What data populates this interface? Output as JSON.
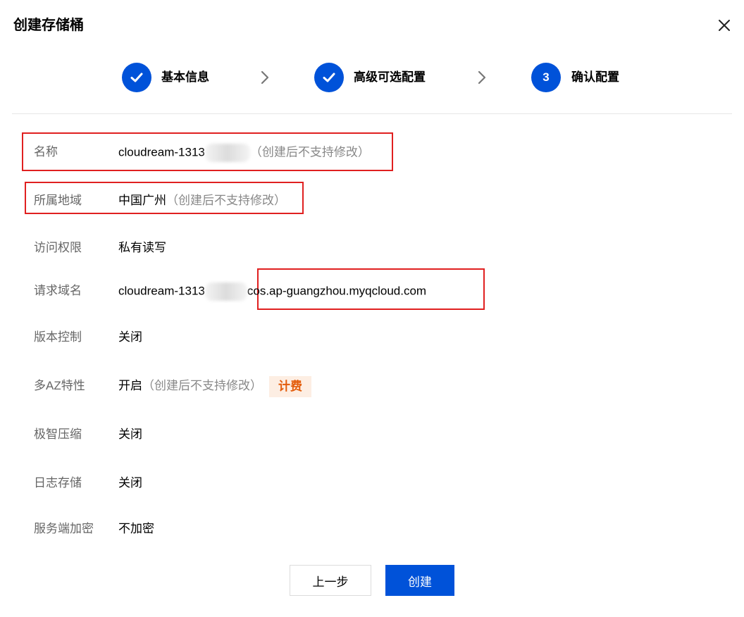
{
  "dialog": {
    "title": "创建存储桶",
    "close_icon": "close-icon"
  },
  "steps": [
    {
      "label": "基本信息",
      "status": "done",
      "icon": "check-icon"
    },
    {
      "label": "高级可选配置",
      "status": "done",
      "icon": "check-icon"
    },
    {
      "label": "确认配置",
      "status": "current",
      "number": "3"
    }
  ],
  "step_separator_icon": "chevron-right-icon",
  "fields": {
    "name": {
      "label": "名称",
      "value": "cloudream-1313",
      "note": "（创建后不支持修改）"
    },
    "region": {
      "label": "所属地域",
      "value": "中国广州",
      "note": "（创建后不支持修改）"
    },
    "access": {
      "label": "访问权限",
      "value": "私有读写"
    },
    "domain": {
      "label": "请求域名",
      "value_prefix": "cloudream-1313",
      "value_suffix": "cos.ap-guangzhou.myqcloud.com"
    },
    "versioning": {
      "label": "版本控制",
      "value": "关闭"
    },
    "multi_az": {
      "label": "多AZ特性",
      "value": "开启",
      "note": "（创建后不支持修改）",
      "badge": "计费"
    },
    "compression": {
      "label": "极智压缩",
      "value": "关闭"
    },
    "logging": {
      "label": "日志存储",
      "value": "关闭"
    },
    "encryption": {
      "label": "服务端加密",
      "value": "不加密"
    }
  },
  "buttons": {
    "prev": "上一步",
    "create": "创建"
  },
  "colors": {
    "primary": "#0052d9",
    "highlight_border": "#e02020",
    "badge_bg": "#fdeee3",
    "badge_text": "#e35c0b"
  }
}
